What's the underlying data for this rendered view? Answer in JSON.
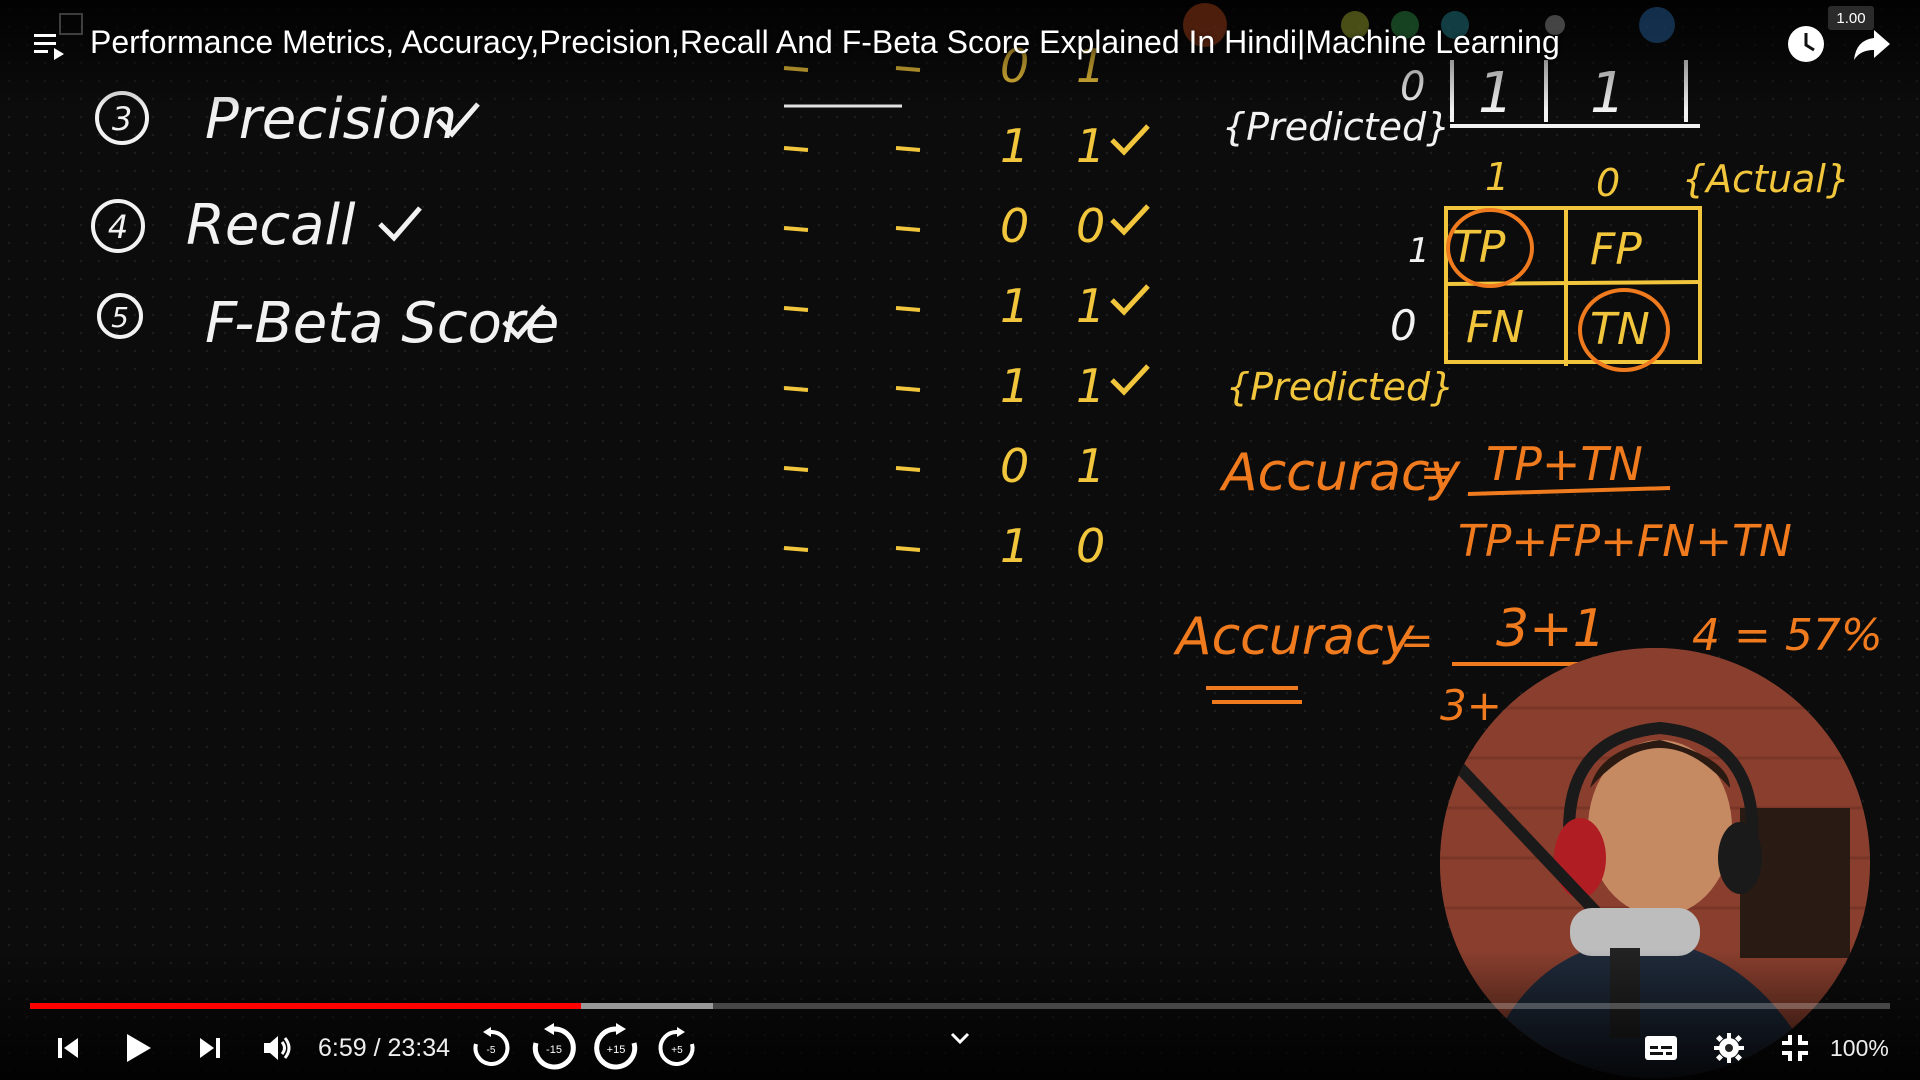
{
  "player": {
    "title": "Performance Metrics, Accuracy,Precision,Recall And F-Beta Score Explained In Hindi|Machine Learning",
    "speed": "1.00",
    "current_time": "6:59",
    "duration": "23:34",
    "time_text": "6:59 / 23:34",
    "zoom": "100%",
    "progress_fraction": 0.296,
    "buffer_fraction": 0.367,
    "accent_color": "#ff0000"
  },
  "controls": {
    "skip_back_small": "-5",
    "skip_back_large": "-15",
    "skip_fwd_large": "+15",
    "skip_fwd_small": "+5"
  },
  "board": {
    "left_list": [
      {
        "num": "3",
        "text": "Precision"
      },
      {
        "num": "4",
        "text": "Recall"
      },
      {
        "num": "5",
        "text": "F-Beta Score"
      }
    ],
    "table_rows": [
      {
        "a": "0",
        "b": "1",
        "check": false
      },
      {
        "a": "1",
        "b": "1",
        "check": true
      },
      {
        "a": "0",
        "b": "0",
        "check": true
      },
      {
        "a": "1",
        "b": "1",
        "check": true
      },
      {
        "a": "1",
        "b": "1",
        "check": true
      },
      {
        "a": "0",
        "b": "1",
        "check": false
      },
      {
        "a": "1",
        "b": "0",
        "check": false
      }
    ],
    "predicted_label_1": "{Predicted}",
    "predicted_label_2": "{Predicted}",
    "actual_label": "{Actual}",
    "top_row": {
      "lead": "0",
      "c1": "1",
      "c2": "1"
    },
    "matrix": {
      "col_headers": [
        "1",
        "0"
      ],
      "row_headers": [
        "1",
        "0"
      ],
      "cells": [
        "TP",
        "FP",
        "FN",
        "TN"
      ]
    },
    "formula": {
      "lhs": "Accuracy",
      "numerator": "TP+TN",
      "denominator": "TP+FP+FN+TN"
    },
    "calc": {
      "lhs": "Accuracy",
      "numerator": "3+1",
      "denominator": "3+",
      "result": "4 = 57%"
    }
  },
  "icons": [
    "playlist-icon",
    "watch-later-icon",
    "share-icon",
    "previous-icon",
    "play-icon",
    "next-icon",
    "volume-icon",
    "rewind-icon",
    "forward-icon",
    "chevron-down-icon",
    "subtitles-icon",
    "settings-icon",
    "exit-fullscreen-icon"
  ]
}
